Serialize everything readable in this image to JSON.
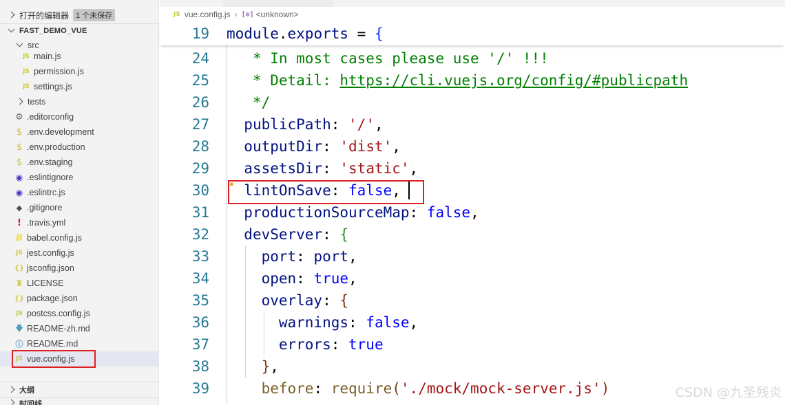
{
  "explorer": {
    "open_editors_label": "打开的编辑器",
    "unsaved_badge": "1 个未保存",
    "project_title": "FAST_DEMO_VUE",
    "folder_src": "src",
    "files_src": [
      "main.js",
      "permission.js",
      "settings.js"
    ],
    "folder_tests": "tests",
    "files_root": [
      {
        "name": ".editorconfig",
        "icon": "gear-icon"
      },
      {
        "name": ".env.development",
        "icon": "dollar-icon"
      },
      {
        "name": ".env.production",
        "icon": "dollar-icon"
      },
      {
        "name": ".env.staging",
        "icon": "dollar-icon"
      },
      {
        "name": ".eslintignore",
        "icon": "eslint-icon"
      },
      {
        "name": ".eslintrc.js",
        "icon": "eslint-icon"
      },
      {
        "name": ".gitignore",
        "icon": "git-icon"
      },
      {
        "name": ".travis.yml",
        "icon": "exclamation-icon"
      },
      {
        "name": "babel.config.js",
        "icon": "babel-icon"
      },
      {
        "name": "jest.config.js",
        "icon": "js-file-icon"
      },
      {
        "name": "jsconfig.json",
        "icon": "json-icon"
      },
      {
        "name": "LICENSE",
        "icon": "license-icon"
      },
      {
        "name": "package.json",
        "icon": "json-icon"
      },
      {
        "name": "postcss.config.js",
        "icon": "js-file-icon"
      },
      {
        "name": "README-zh.md",
        "icon": "markdown-icon"
      },
      {
        "name": "README.md",
        "icon": "info-icon"
      },
      {
        "name": "vue.config.js",
        "icon": "js-file-icon"
      }
    ],
    "outline_label": "大纲",
    "timeline_label": "时间线",
    "js_icon_text": "JS",
    "gear_glyph": "⚙",
    "dollar_glyph": "$",
    "eslint_glyph": "◉",
    "git_glyph": "◆",
    "excl_glyph": "!",
    "babel_glyph": "B",
    "json_glyph": "{}",
    "license_glyph": "♜",
    "md_glyph": "🡇",
    "info_glyph": "ⓘ"
  },
  "breadcrumb": {
    "file": "vue.config.js",
    "symbol_icon": "[⊙]",
    "symbol": "<unknown>"
  },
  "editor": {
    "sticky": {
      "line": "19",
      "module": "module",
      "dot": ".",
      "exports": "exports",
      "eq": " = ",
      "brace": "{"
    },
    "lines": {
      "l24": {
        "num": "24",
        "text": " * In most cases please use '/' !!!"
      },
      "l25": {
        "num": "25",
        "pre": " * Detail: ",
        "url": "https://cli.vuejs.org/config/#publicpath"
      },
      "l26": {
        "num": "26",
        "text": " */"
      },
      "l27": {
        "num": "27",
        "key": "publicPath",
        "colon": ": ",
        "val": "'/'",
        "end": ","
      },
      "l28": {
        "num": "28",
        "key": "outputDir",
        "colon": ": ",
        "val": "'dist'",
        "end": ","
      },
      "l29": {
        "num": "29",
        "key": "assetsDir",
        "colon": ": ",
        "val": "'static'",
        "end": ","
      },
      "l30": {
        "num": "30",
        "key": "lintOnSave",
        "colon": ": ",
        "val": "false",
        "end": ","
      },
      "l31": {
        "num": "31",
        "key": "productionSourceMap",
        "colon": ": ",
        "val": "false",
        "end": ","
      },
      "l32": {
        "num": "32",
        "key": "devServer",
        "colon": ": ",
        "brace": "{"
      },
      "l33": {
        "num": "33",
        "key": "port",
        "colon": ": ",
        "val": "port",
        "end": ","
      },
      "l34": {
        "num": "34",
        "key": "open",
        "colon": ": ",
        "val": "true",
        "end": ","
      },
      "l35": {
        "num": "35",
        "key": "overlay",
        "colon": ": ",
        "brace": "{"
      },
      "l36": {
        "num": "36",
        "key": "warnings",
        "colon": ": ",
        "val": "false",
        "end": ","
      },
      "l37": {
        "num": "37",
        "key": "errors",
        "colon": ": ",
        "val": "true"
      },
      "l38": {
        "num": "38",
        "close": "}",
        "end": ","
      },
      "l39": {
        "num": "39",
        "fn": "before",
        "colon": ": ",
        "call": "require",
        "po": "(",
        "arg": "'./mock/mock-server.js'",
        "pc": ")"
      }
    }
  },
  "watermark": "CSDN @九圣残炎",
  "colors": {
    "highlight_box": "#e02020",
    "keyword": "#0000ff",
    "string": "#a31515",
    "comment": "#008000",
    "property": "#001080",
    "line_number": "#237893"
  }
}
